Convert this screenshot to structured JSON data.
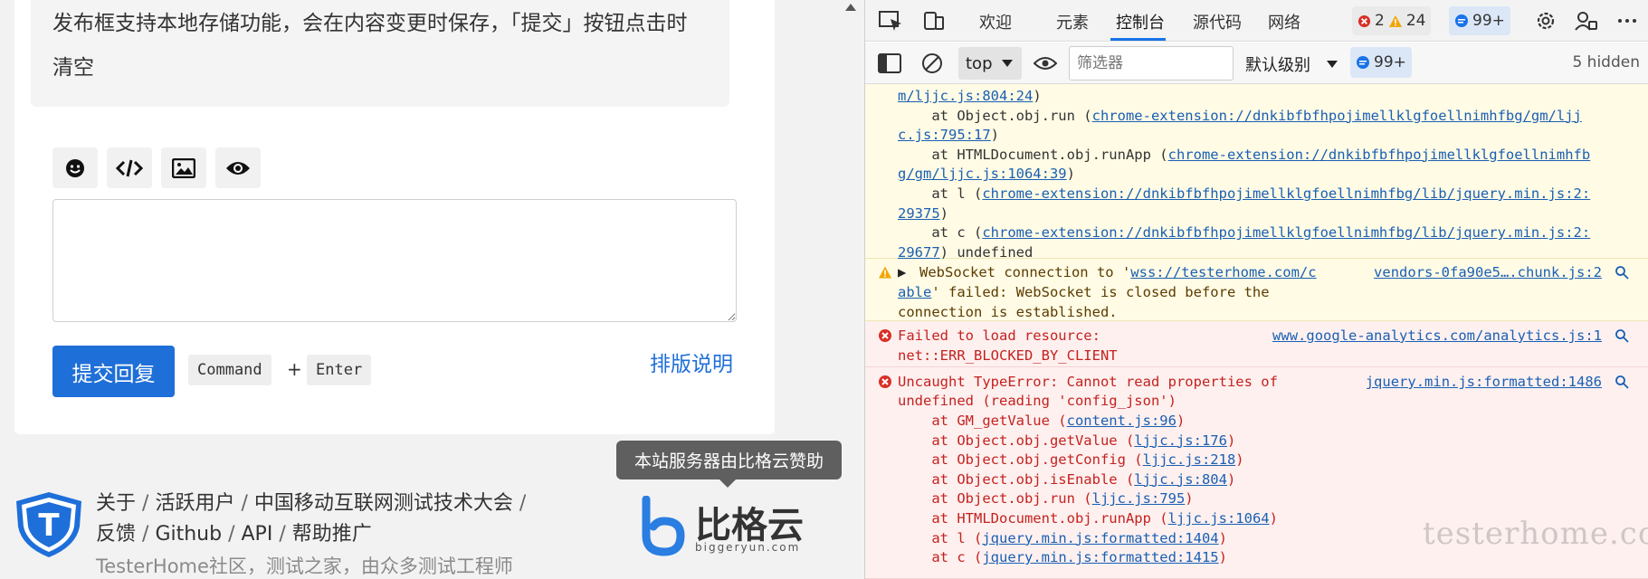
{
  "page": {
    "note_text": "发布框支持本地存储功能，会在内容变更时保存，「提交」按钮点击时清空",
    "toolbar_icons": [
      "smile-icon",
      "code-icon",
      "image-icon",
      "eye-icon"
    ],
    "editor_value": "",
    "submit_label": "提交回复",
    "kbd_command": "Command",
    "kbd_plus": "+",
    "kbd_enter": "Enter",
    "format_link": "排版说明",
    "footer": {
      "logo_letter": "T",
      "links": [
        "关于",
        "活跃用户",
        "中国移动互联网测试技术大会",
        "反馈",
        "Github",
        "API",
        "帮助推广"
      ],
      "separator": "/",
      "description": "TesterHome社区，测试之家，由众多测试工程师"
    },
    "tooltip": "本站服务器由比格云赞助",
    "sponsor": {
      "name": "比格云",
      "domain": "biggeryun.com"
    }
  },
  "devtools": {
    "tabs": [
      "欢迎",
      "元素",
      "控制台",
      "源代码",
      "网络"
    ],
    "active_tab": "控制台",
    "error_count": "2",
    "warning_count": "24",
    "message_count": "99+",
    "context": "top",
    "filter_placeholder": "筛选器",
    "level": "默认级别",
    "issues_count": "99+",
    "hidden": "5 hidden",
    "console": {
      "first_block": {
        "lines": [
          {
            "pre": "",
            "link": "m/ljjc.js:804:24",
            "post": ")"
          },
          {
            "pre": "    at Object.obj.run (",
            "link": "chrome-extension://dnkibfbfhpojimellklgfoellnimhfbg/gm/ljj",
            "post": ""
          },
          {
            "pre": "",
            "link": "c.js:795:17",
            "post": ")"
          },
          {
            "pre": "    at HTMLDocument.obj.runApp (",
            "link": "chrome-extension://dnkibfbfhpojimellklgfoellnimhfb",
            "post": ""
          },
          {
            "pre": "",
            "link": "g/gm/ljjc.js:1064:39",
            "post": ")"
          },
          {
            "pre": "    at l (",
            "link": "chrome-extension://dnkibfbfhpojimellklgfoellnimhfbg/lib/jquery.min.js:2:",
            "post": ""
          },
          {
            "pre": "",
            "link": "29375",
            "post": ")"
          },
          {
            "pre": "    at c (",
            "link": "chrome-extension://dnkibfbfhpojimellklgfoellnimhfbg/lib/jquery.min.js:2:",
            "post": ""
          },
          {
            "pre": "",
            "link": "29677",
            "post": ") undefined"
          }
        ]
      },
      "websocket_warning": {
        "pre": "WebSocket connection to '",
        "link1": "wss://testerhome.com/c",
        "link2": "able",
        "post": "' failed: WebSocket is closed before the",
        "line3": "connection is established.",
        "source": "vendors-0fa90e5….chunk.js:2"
      },
      "load_error": {
        "line1": "Failed to load resource:",
        "line2": "net::ERR_BLOCKED_BY_CLIENT",
        "source": "www.google-analytics.com/analytics.js:1"
      },
      "type_error": {
        "line1": "Uncaught TypeError: Cannot read properties of",
        "line2": "undefined (reading 'config_json')",
        "source": "jquery.min.js:formatted:1486",
        "frames": [
          {
            "fn": "GM_getValue",
            "loc": "content.js:96"
          },
          {
            "fn": "Object.obj.getValue",
            "loc": "ljjc.js:176"
          },
          {
            "fn": "Object.obj.getConfig",
            "loc": "ljjc.js:218"
          },
          {
            "fn": "Object.obj.isEnable",
            "loc": "ljjc.js:804"
          },
          {
            "fn": "Object.obj.run",
            "loc": "ljjc.js:795"
          },
          {
            "fn": "HTMLDocument.obj.runApp",
            "loc": "ljjc.js:1064"
          },
          {
            "fn": "l",
            "loc": "jquery.min.js:formatted:1404"
          },
          {
            "fn": "c",
            "loc": "jquery.min.js:formatted:1415"
          }
        ]
      }
    },
    "watermark": "testerhome.com"
  }
}
